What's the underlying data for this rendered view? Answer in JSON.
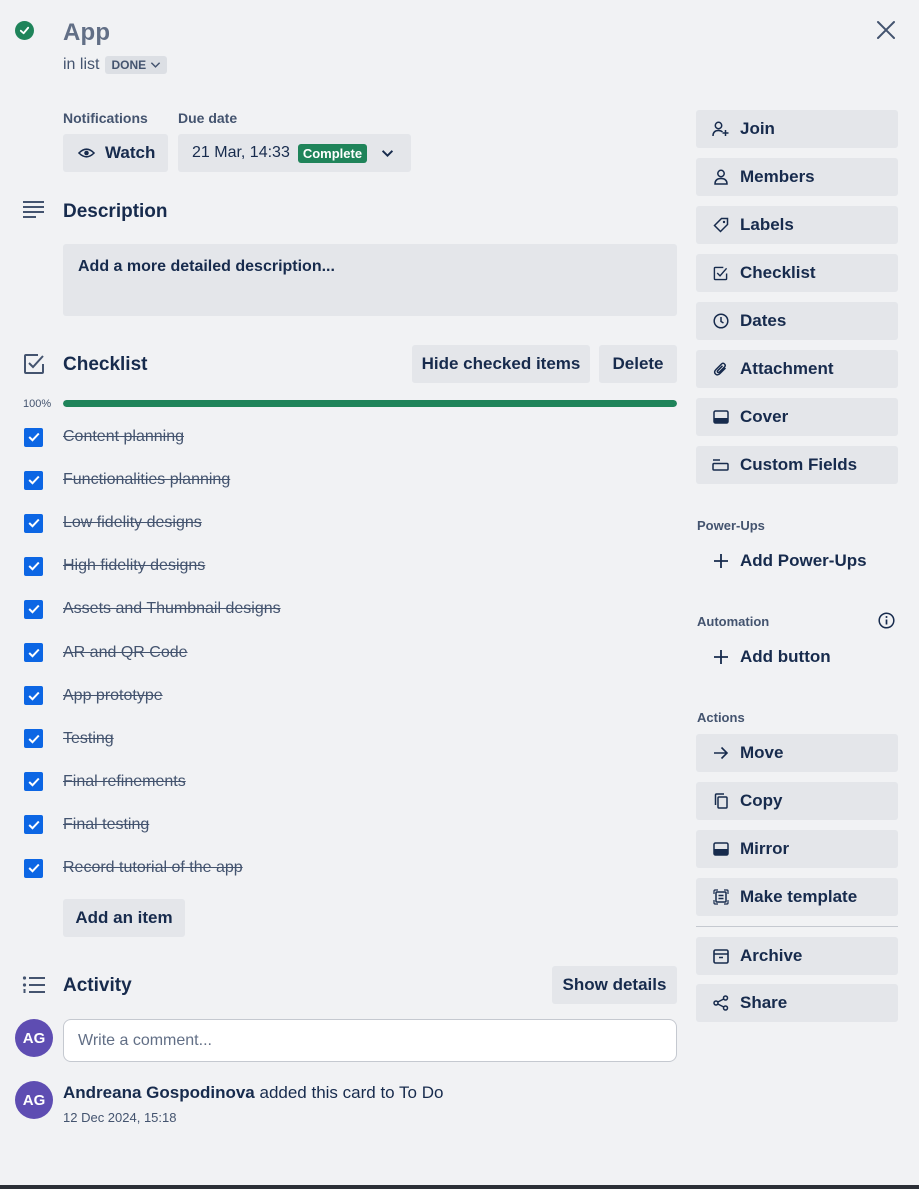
{
  "card": {
    "title": "App",
    "in_list_prefix": "in list",
    "list_name": "DONE"
  },
  "notifications": {
    "label": "Notifications",
    "watch_label": "Watch"
  },
  "due_date": {
    "label": "Due date",
    "value": "21 Mar, 14:33",
    "status": "Complete"
  },
  "description": {
    "title": "Description",
    "placeholder": "Add a more detailed description..."
  },
  "checklist": {
    "title": "Checklist",
    "hide_checked_label": "Hide checked items",
    "delete_label": "Delete",
    "progress_label": "100%",
    "progress_fraction": 1.0,
    "items": [
      {
        "text": "Content planning",
        "checked": true
      },
      {
        "text": "Functionalities planning",
        "checked": true
      },
      {
        "text": "Low fidelity designs",
        "checked": true
      },
      {
        "text": "High fidelity designs",
        "checked": true
      },
      {
        "text": "Assets and Thumbnail designs",
        "checked": true
      },
      {
        "text": "AR and QR Code",
        "checked": true
      },
      {
        "text": "App prototype",
        "checked": true
      },
      {
        "text": "Testing",
        "checked": true
      },
      {
        "text": "Final refinements",
        "checked": true
      },
      {
        "text": "Final testing",
        "checked": true
      },
      {
        "text": "Record tutorial of the app",
        "checked": true
      }
    ],
    "add_item_label": "Add an item"
  },
  "activity": {
    "title": "Activity",
    "show_details_label": "Show details",
    "comment_placeholder": "Write a comment...",
    "user_initials": "AG",
    "entries": [
      {
        "initials": "AG",
        "author": "Andreana Gospodinova",
        "action": "added this card to To Do",
        "timestamp": "12 Dec 2024, 15:18"
      }
    ]
  },
  "sidebar": {
    "add_to_card": [
      {
        "label": "Join",
        "icon": "person-add-icon"
      },
      {
        "label": "Members",
        "icon": "person-icon"
      },
      {
        "label": "Labels",
        "icon": "tag-icon"
      },
      {
        "label": "Checklist",
        "icon": "checkbox-icon"
      },
      {
        "label": "Dates",
        "icon": "clock-icon"
      },
      {
        "label": "Attachment",
        "icon": "paperclip-icon"
      },
      {
        "label": "Cover",
        "icon": "cover-icon"
      },
      {
        "label": "Custom Fields",
        "icon": "custom-fields-icon"
      }
    ],
    "powerups_heading": "Power-Ups",
    "add_powerups_label": "Add Power-Ups",
    "automation_heading": "Automation",
    "add_button_label": "Add button",
    "actions_heading": "Actions",
    "actions": [
      {
        "label": "Move",
        "icon": "arrow-right-icon"
      },
      {
        "label": "Copy",
        "icon": "copy-icon"
      },
      {
        "label": "Mirror",
        "icon": "mirror-icon"
      },
      {
        "label": "Make template",
        "icon": "template-icon"
      }
    ],
    "archive_label": "Archive",
    "share_label": "Share"
  },
  "colors": {
    "accent_green": "#1f845a",
    "checkbox_blue": "#0c66e4",
    "avatar_purple": "#5e4db2",
    "panel_bg": "#f1f2f4",
    "button_bg": "#e4e6ea"
  }
}
